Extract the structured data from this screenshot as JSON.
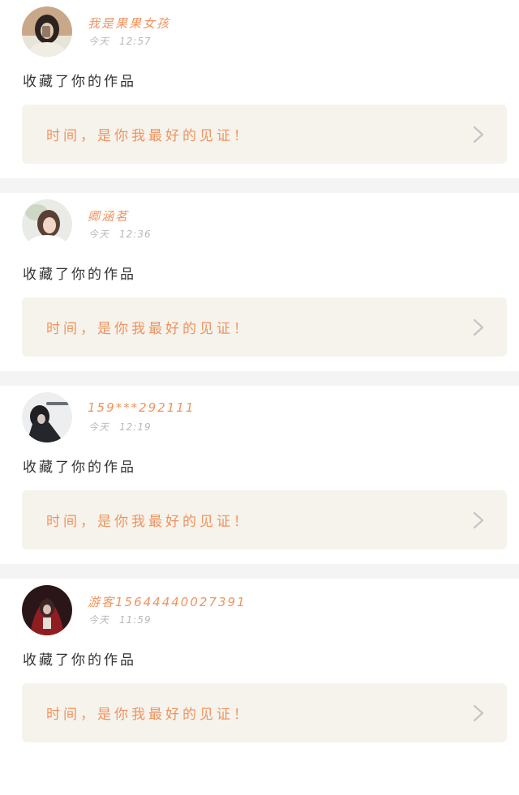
{
  "colors": {
    "accent": "#f0935f",
    "card_bg": "#f5f3ec",
    "divider": "#f4f4f4",
    "time_text": "#b8b8b8",
    "body_text": "#333333",
    "chevron": "#c4c4c4"
  },
  "feed": {
    "items": [
      {
        "name": "我是果果女孩",
        "day": "今天",
        "time": "12:57",
        "action": "收藏了你的作品",
        "card_text": "时间，是你我最好的见证！"
      },
      {
        "name": "卿涵茗",
        "day": "今天",
        "time": "12:36",
        "action": "收藏了你的作品",
        "card_text": "时间，是你我最好的见证！"
      },
      {
        "name": "159***292111",
        "day": "今天",
        "time": "12:19",
        "action": "收藏了你的作品",
        "card_text": "时间，是你我最好的见证！"
      },
      {
        "name": "游客15644440027391",
        "day": "今天",
        "time": "11:59",
        "action": "收藏了你的作品",
        "card_text": "时间，是你我最好的见证！"
      }
    ]
  },
  "icons": {
    "chevron": "chevron-right-icon",
    "avatar": "user-avatar"
  }
}
